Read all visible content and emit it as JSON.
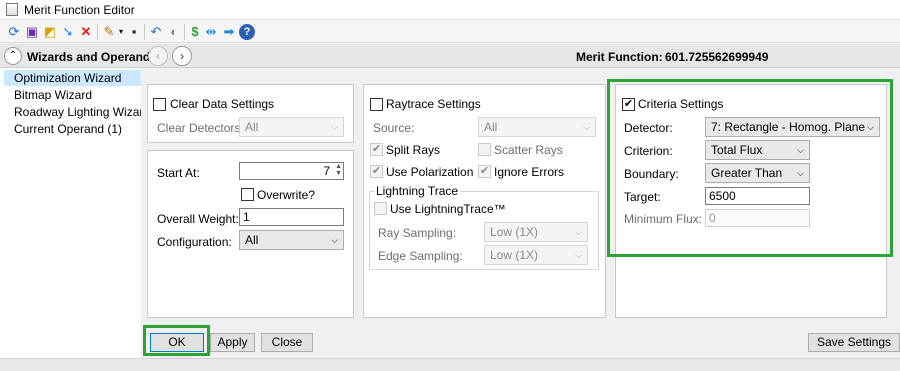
{
  "window": {
    "title": "Merit Function Editor"
  },
  "toolbar": {
    "icons": [
      "refresh-icon",
      "save-icon",
      "load-icon",
      "insert-arrow-icon",
      "delete-x-icon",
      "wizard-wand-icon",
      "operand-icon",
      "undo-icon",
      "toggle-icon",
      "sort-icon",
      "shift-left-right-icon",
      "arrow-right-icon",
      "help-icon"
    ]
  },
  "header": {
    "wizards_label": "Wizards and Operands",
    "merit_label": "Merit Function:",
    "merit_value": "601.725562699949"
  },
  "sidebar": {
    "items": [
      {
        "label": "Optimization Wizard",
        "selected": true
      },
      {
        "label": "Bitmap Wizard",
        "selected": false
      },
      {
        "label": "Roadway Lighting Wizard",
        "selected": false
      },
      {
        "label": "Current Operand (1)",
        "selected": false
      }
    ]
  },
  "clear_panel": {
    "checkbox_label": "Clear Data Settings",
    "detectors_label": "Clear Detectors:",
    "detectors_value": "All"
  },
  "start_panel": {
    "start_label": "Start At:",
    "start_value": "7",
    "overwrite_label": "Overwrite?",
    "weight_label": "Overall Weight:",
    "weight_value": "1",
    "config_label": "Configuration:",
    "config_value": "All"
  },
  "raytrace_panel": {
    "checkbox_label": "Raytrace Settings",
    "source_label": "Source:",
    "source_value": "All",
    "split_rays_label": "Split Rays",
    "scatter_rays_label": "Scatter Rays",
    "use_polarization_label": "Use Polarization",
    "ignore_errors_label": "Ignore Errors",
    "lightning_group_title": "Lightning Trace",
    "use_lightning_label": "Use LightningTrace™",
    "ray_sampling_label": "Ray Sampling:",
    "ray_sampling_value": "Low (1X)",
    "edge_sampling_label": "Edge Sampling:",
    "edge_sampling_value": "Low (1X)"
  },
  "criteria_panel": {
    "checkbox_label": "Criteria Settings",
    "detector_label": "Detector:",
    "detector_value": "7: Rectangle - Homog. Plane",
    "criterion_label": "Criterion:",
    "criterion_value": "Total Flux",
    "boundary_label": "Boundary:",
    "boundary_value": "Greater Than",
    "target_label": "Target:",
    "target_value": "6500",
    "min_flux_label": "Minimum Flux:",
    "min_flux_value": "0"
  },
  "footer": {
    "ok_label": "OK",
    "apply_label": "Apply",
    "close_label": "Close",
    "save_settings_label": "Save Settings"
  },
  "colors": {
    "highlight": "#2ea336",
    "selection": "#cce8ff"
  }
}
